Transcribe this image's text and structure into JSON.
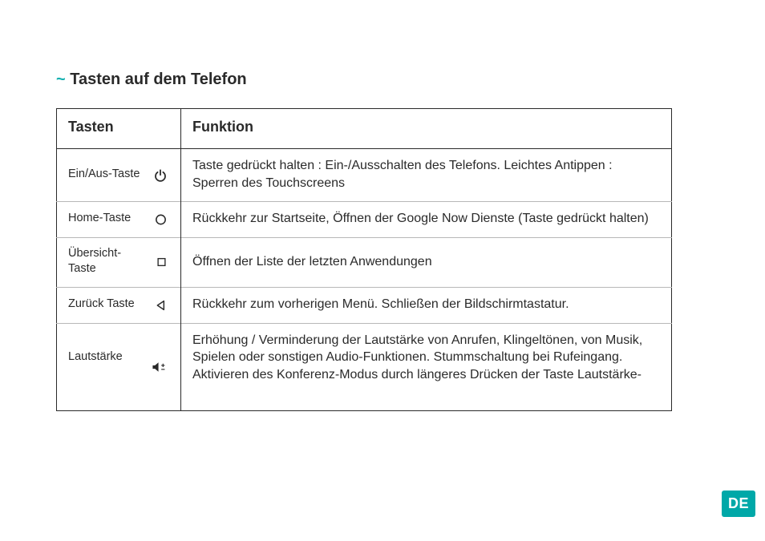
{
  "heading": {
    "prefix": "~",
    "text": "Tasten auf dem Telefon"
  },
  "table": {
    "headers": {
      "col1": "Tasten",
      "col2": "Funktion"
    },
    "rows": [
      {
        "key": "Ein/Aus-Taste",
        "icon": "power-icon",
        "func": "Taste gedrückt halten : Ein-/Ausschalten des Telefons. Leichtes Antippen : Sperren des Touchscreens"
      },
      {
        "key": "Home-Taste",
        "icon": "home-circle-icon",
        "func": "Rückkehr zur Startseite,  Öffnen der Google Now Dienste (Taste gedrückt halten)"
      },
      {
        "key": "Übersicht-Taste",
        "icon": "overview-square-icon",
        "func": "Öffnen der Liste der letzten Anwendungen"
      },
      {
        "key": "Zurück Taste",
        "icon": "back-triangle-icon",
        "func": "Rückkehr zum vorherigen Menü. Schließen der Bildschirm­tastatur."
      },
      {
        "key": "Lautstärke",
        "icon": "volume-icon",
        "func": "Erhöhung / Verminderung der Lautstärke von Anrufen, Klin­geltönen, von Musik, Spielen oder sonstigen Audio-Funktionen. Stummschaltung bei Rufeingang.  Aktivieren des Konfe­renz-Modus durch längeres Drücken der Taste Lautstärke-"
      }
    ]
  },
  "lang_badge": "DE",
  "colors": {
    "accent": "#00a8a8"
  }
}
